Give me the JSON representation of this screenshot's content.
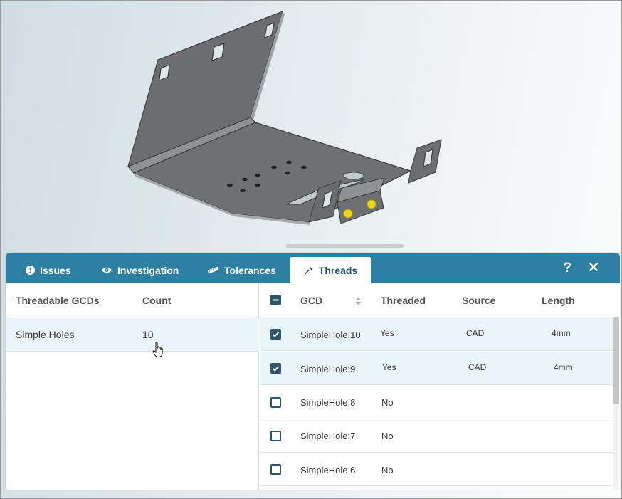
{
  "tabs": [
    {
      "label": "Issues",
      "icon": "exclamation-circle-icon"
    },
    {
      "label": "Investigation",
      "icon": "eye-icon"
    },
    {
      "label": "Tolerances",
      "icon": "ruler-icon"
    },
    {
      "label": "Threads",
      "icon": "screwdriver-icon",
      "active": true
    }
  ],
  "toolbar": {
    "help_label": "?",
    "close_icon": "close-icon"
  },
  "left_table": {
    "columns": [
      "Threadable GCDs",
      "Count"
    ],
    "rows": [
      {
        "name": "Simple Holes",
        "count": "10"
      }
    ]
  },
  "right_table": {
    "columns": [
      "GCD",
      "Threaded",
      "Source",
      "Length"
    ],
    "select_all_state": "indeterminate",
    "rows": [
      {
        "checked": true,
        "gcd": "SimpleHole:10",
        "threaded": "Yes",
        "source": "CAD",
        "length": "4mm"
      },
      {
        "checked": true,
        "gcd": "SimpleHole:9",
        "threaded": "Yes",
        "source": "CAD",
        "length": "4mm"
      },
      {
        "checked": false,
        "gcd": "SimpleHole:8",
        "threaded": "No",
        "source": "",
        "length": ""
      },
      {
        "checked": false,
        "gcd": "SimpleHole:7",
        "threaded": "No",
        "source": "",
        "length": ""
      },
      {
        "checked": false,
        "gcd": "SimpleHole:6",
        "threaded": "No",
        "source": "",
        "length": ""
      }
    ]
  },
  "colors": {
    "tabbar": "#2e80a2",
    "active_tab_text": "#2b5569",
    "checkbox": "#2c5668",
    "selected_row": "#eaf5fa",
    "part_metal": "#6b6f72",
    "thread_marker": "#f2d61e"
  }
}
